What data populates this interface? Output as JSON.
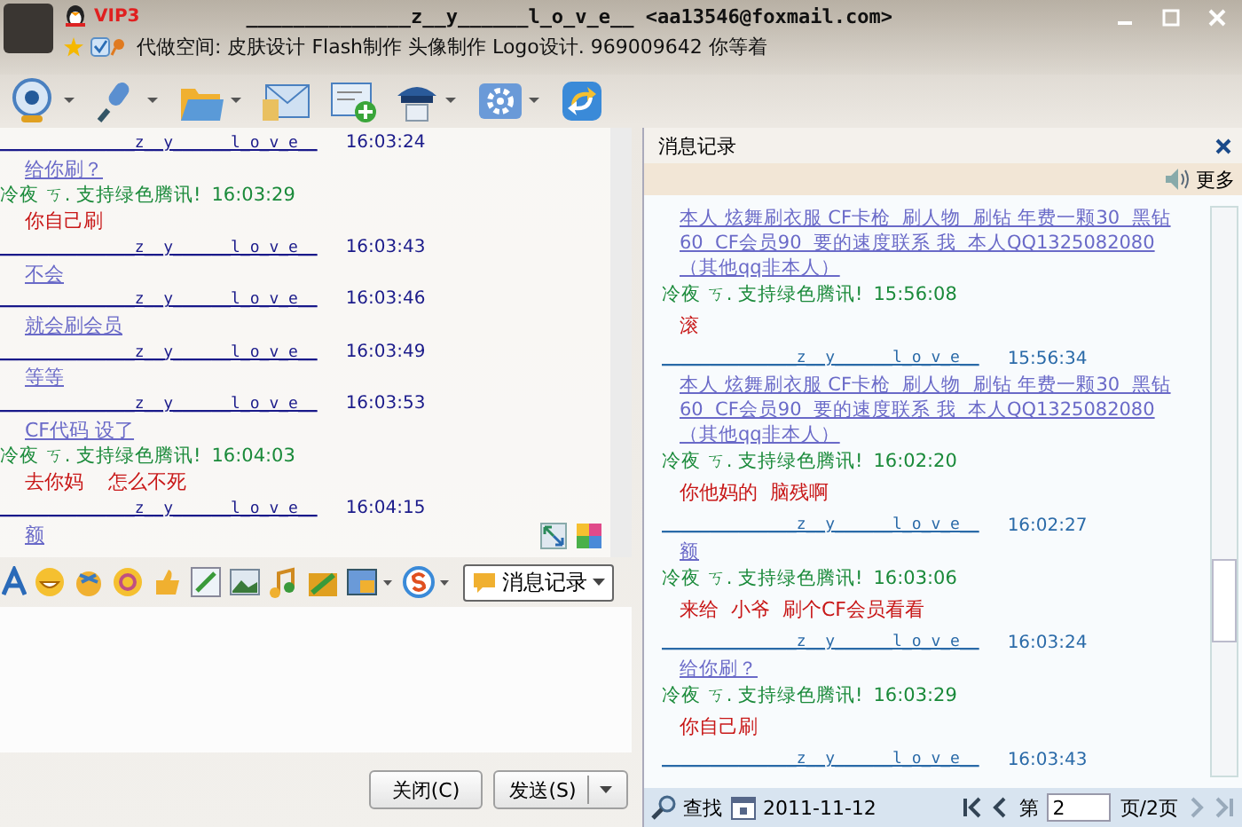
{
  "header": {
    "badge": "VIP3",
    "name": "______________z__y______l_o_v_e__ <aa13546@foxmail.com>",
    "signature": "代做空间: 皮肤设计 Flash制作 头像制作 Logo设计. 969009642 你等着"
  },
  "chat": {
    "messages": [
      {
        "kind": "peer",
        "sender": "______________z__y______l_o_v_e__",
        "time": "16:03:24",
        "text": "给你刷？"
      },
      {
        "kind": "self",
        "sender": "冷夜 ㄎ. 支持绿色腾讯!",
        "time": "16:03:29",
        "text": "你自己刷"
      },
      {
        "kind": "peer",
        "sender": "______________z__y______l_o_v_e__",
        "time": "16:03:43",
        "text": "不会"
      },
      {
        "kind": "peer",
        "sender": "______________z__y______l_o_v_e__",
        "time": "16:03:46",
        "text": "就会刷会员"
      },
      {
        "kind": "peer",
        "sender": "______________z__y______l_o_v_e__",
        "time": "16:03:49",
        "text": "等等"
      },
      {
        "kind": "peer",
        "sender": "______________z__y______l_o_v_e__",
        "time": "16:03:53",
        "text": "CF代码 设了"
      },
      {
        "kind": "self",
        "sender": "冷夜 ㄎ. 支持绿色腾讯!",
        "time": "16:04:03",
        "text": "去你妈    怎么不死"
      },
      {
        "kind": "peer",
        "sender": "______________z__y______l_o_v_e__",
        "time": "16:04:15",
        "text": "额"
      }
    ]
  },
  "history_button": "消息记录",
  "buttons": {
    "close": "关闭(C)",
    "send": "发送(S)"
  },
  "history": {
    "title": "消息记录",
    "more": "更多",
    "messages": [
      {
        "kind": "peer",
        "text": "本人 炫舞刷衣服 CF卡枪  刷人物  刷钻 年费一颗30  黑钻60  CF会员90  要的速度联系 我  本人QQ1325082080（其他qq非本人）"
      },
      {
        "kind": "self",
        "sender": "冷夜 ㄎ. 支持绿色腾讯!",
        "time": "15:56:08",
        "text": "滚"
      },
      {
        "kind": "peer",
        "sender": "______________z__y______l_o_v_e__",
        "time": "15:56:34",
        "text": "本人 炫舞刷衣服 CF卡枪  刷人物  刷钻 年费一颗30  黑钻60  CF会员90  要的速度联系 我  本人QQ1325082080（其他qq非本人）"
      },
      {
        "kind": "self",
        "sender": "冷夜 ㄎ. 支持绿色腾讯!",
        "time": "16:02:20",
        "text": "你他妈的  脑残啊"
      },
      {
        "kind": "peer",
        "sender": "______________z__y______l_o_v_e__",
        "time": "16:02:27",
        "text": "额"
      },
      {
        "kind": "self",
        "sender": "冷夜 ㄎ. 支持绿色腾讯!",
        "time": "16:03:06",
        "text": "来给  小爷  刷个CF会员看看"
      },
      {
        "kind": "peer",
        "sender": "______________z__y______l_o_v_e__",
        "time": "16:03:24",
        "text": "给你刷？"
      },
      {
        "kind": "self",
        "sender": "冷夜 ㄎ. 支持绿色腾讯!",
        "time": "16:03:29",
        "text": "你自己刷"
      },
      {
        "kind": "peer",
        "sender": "______________z__y______l_o_v_e__",
        "time": "16:03:43"
      }
    ],
    "find": "查找",
    "date": "2011-11-12",
    "page_prefix": "第",
    "page": "2",
    "page_suffix": "页/2页"
  }
}
